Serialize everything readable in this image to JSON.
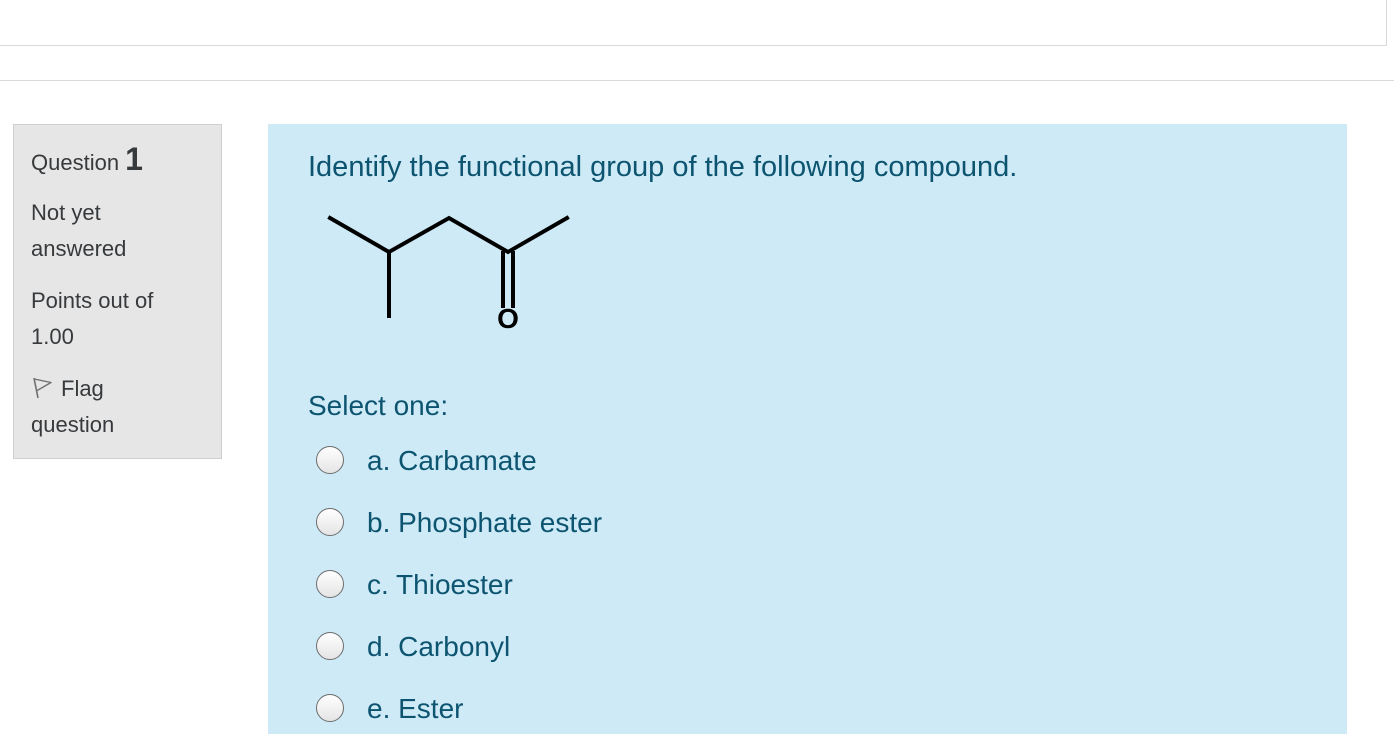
{
  "question": {
    "label": "Question",
    "number": "1",
    "state_line1": "Not yet",
    "state_line2": "answered",
    "grade_line1": "Points out of",
    "grade_line2": "1.00",
    "flag_line1": "Flag",
    "flag_line2": "question",
    "text": "Identify the functional group of the following compound.",
    "molecule_atom_label": "O",
    "prompt": "Select one:",
    "options": [
      {
        "label": "a. Carbamate",
        "selected": false
      },
      {
        "label": "b. Phosphate ester",
        "selected": false
      },
      {
        "label": "c. Thioester",
        "selected": false
      },
      {
        "label": "d. Carbonyl",
        "selected": false
      },
      {
        "label": "e. Ester",
        "selected": false
      }
    ]
  },
  "colors": {
    "info_background": "#e7e6e6",
    "content_background": "#cdeaf6",
    "content_text": "#0d5470"
  }
}
